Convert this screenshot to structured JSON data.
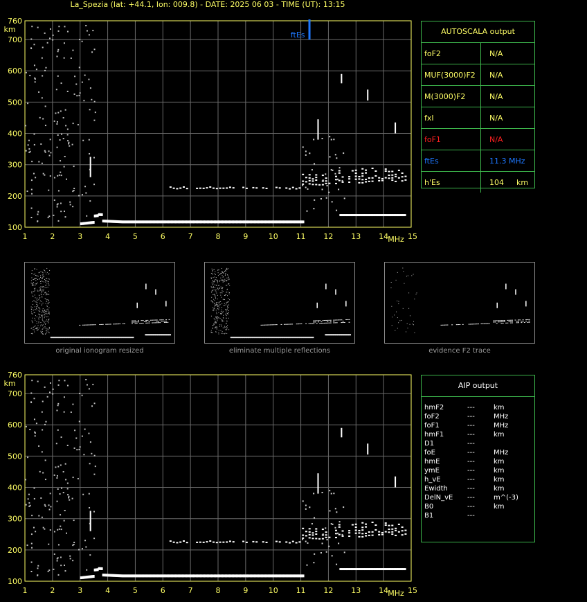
{
  "title": "La_Spezia (lat: +44.1, lon: 009.8) - DATE: 2025 06 03 - TIME (UT): 13:15",
  "colors": {
    "axis": "#ffff66",
    "grid": "#6b6b6b",
    "panel": "#3cb44b",
    "echo": "#ffffff",
    "ftes": "#1e78ff",
    "foF1": "#ff2020",
    "label": "#ffff66"
  },
  "chart_data": [
    {
      "type": "scatter",
      "name": "ionogram-top",
      "xlabel": "MHz",
      "ylabel": "km",
      "xlim": [
        1,
        15
      ],
      "ylim": [
        100,
        760
      ],
      "xticks": [
        "1",
        "2",
        "3",
        "4",
        "5",
        "6",
        "7",
        "8",
        "9",
        "10",
        "11",
        "12",
        "13",
        "14",
        "15"
      ],
      "yticks": [
        "100",
        "200",
        "300",
        "400",
        "500",
        "600",
        "700",
        "760"
      ],
      "grid": true,
      "marker": {
        "label": "ftEs",
        "x": 11.3
      }
    },
    {
      "type": "scatter",
      "name": "ionogram-bottom",
      "xlabel": "MHz",
      "ylabel": "km",
      "xlim": [
        1,
        15
      ],
      "ylim": [
        100,
        760
      ],
      "xticks": [
        "1",
        "2",
        "3",
        "4",
        "5",
        "6",
        "7",
        "8",
        "9",
        "10",
        "11",
        "12",
        "13",
        "14",
        "15"
      ],
      "yticks": [
        "100",
        "200",
        "300",
        "400",
        "500",
        "600",
        "700",
        "760"
      ],
      "grid": true
    }
  ],
  "thumbnails": [
    {
      "caption": "original ionogram resized"
    },
    {
      "caption": "eliminate multiple reflections"
    },
    {
      "caption": "evidence F2 trace"
    }
  ],
  "autoscala": {
    "header": "AUTOSCALA output",
    "rows": [
      {
        "label": "foF2",
        "value": "N/A",
        "unit": "",
        "color": "#ffff66"
      },
      {
        "label": "MUF(3000)F2",
        "value": "N/A",
        "unit": "",
        "color": "#ffff66"
      },
      {
        "label": "M(3000)F2",
        "value": "N/A",
        "unit": "",
        "color": "#ffff66"
      },
      {
        "label": "fxI",
        "value": "N/A",
        "unit": "",
        "color": "#ffff66"
      },
      {
        "label": "foF1",
        "value": "N/A",
        "unit": "",
        "color": "#ff2020"
      },
      {
        "label": "ftEs",
        "value": "11.3 MHz",
        "unit": "",
        "color": "#1e78ff"
      },
      {
        "label": "h'Es",
        "value": "104",
        "unit": "km",
        "color": "#ffff66"
      }
    ]
  },
  "aip": {
    "header": "AIP output",
    "rows": [
      {
        "label": "hmF2",
        "value": "---",
        "unit": "km"
      },
      {
        "label": "foF2",
        "value": "---",
        "unit": "MHz"
      },
      {
        "label": "foF1",
        "value": "---",
        "unit": "MHz"
      },
      {
        "label": "hmF1",
        "value": "---",
        "unit": "km"
      },
      {
        "label": "D1",
        "value": "---",
        "unit": ""
      },
      {
        "label": "foE",
        "value": "---",
        "unit": "MHz"
      },
      {
        "label": "hmE",
        "value": "---",
        "unit": "km"
      },
      {
        "label": "ymE",
        "value": "---",
        "unit": "km"
      },
      {
        "label": "h_vE",
        "value": "---",
        "unit": "km"
      },
      {
        "label": "Ewidth",
        "value": "---",
        "unit": "km"
      },
      {
        "label": "DelN_vE",
        "value": "---",
        "unit": "m^(-3)"
      },
      {
        "label": "B0",
        "value": "---",
        "unit": "km"
      },
      {
        "label": "B1",
        "value": "---",
        "unit": ""
      }
    ]
  }
}
